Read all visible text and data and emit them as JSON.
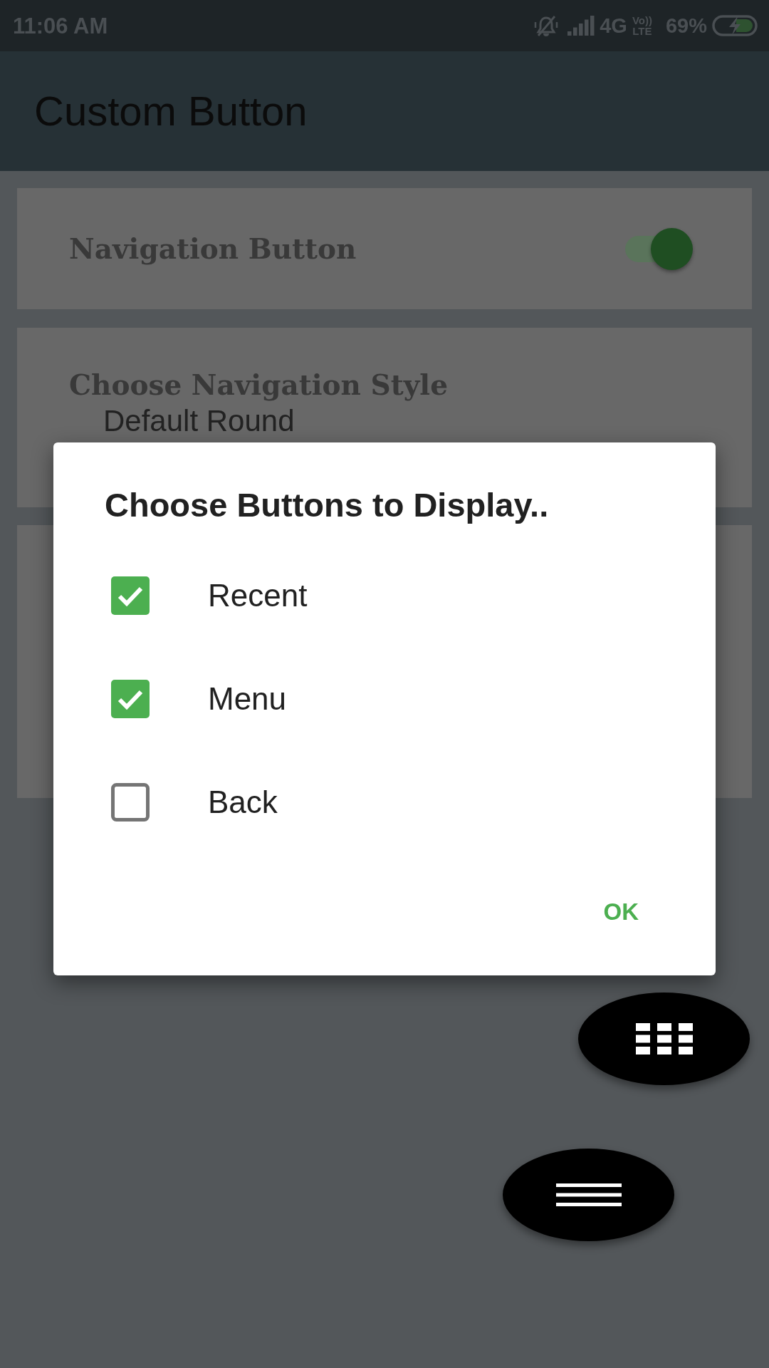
{
  "status_bar": {
    "time": "11:06 AM",
    "network": "4G",
    "volte": [
      "Vo))",
      "LTE"
    ],
    "battery": "69%"
  },
  "app_bar": {
    "title": "Custom Button"
  },
  "cards": [
    {
      "kind": "switch",
      "title": "Navigation Button",
      "on": true
    },
    {
      "kind": "options",
      "title": "Choose Navigation Style",
      "options": [
        "Default Round"
      ]
    },
    {
      "kind": "empty"
    }
  ],
  "dialog": {
    "title": "Choose Buttons to Display..",
    "items": [
      {
        "label": "Recent",
        "checked": true
      },
      {
        "label": "Menu",
        "checked": true
      },
      {
        "label": "Back",
        "checked": false
      }
    ],
    "buttons": [
      "OK"
    ]
  },
  "floating_buttons": [
    {
      "kind": "grid"
    },
    {
      "kind": "menu"
    }
  ]
}
